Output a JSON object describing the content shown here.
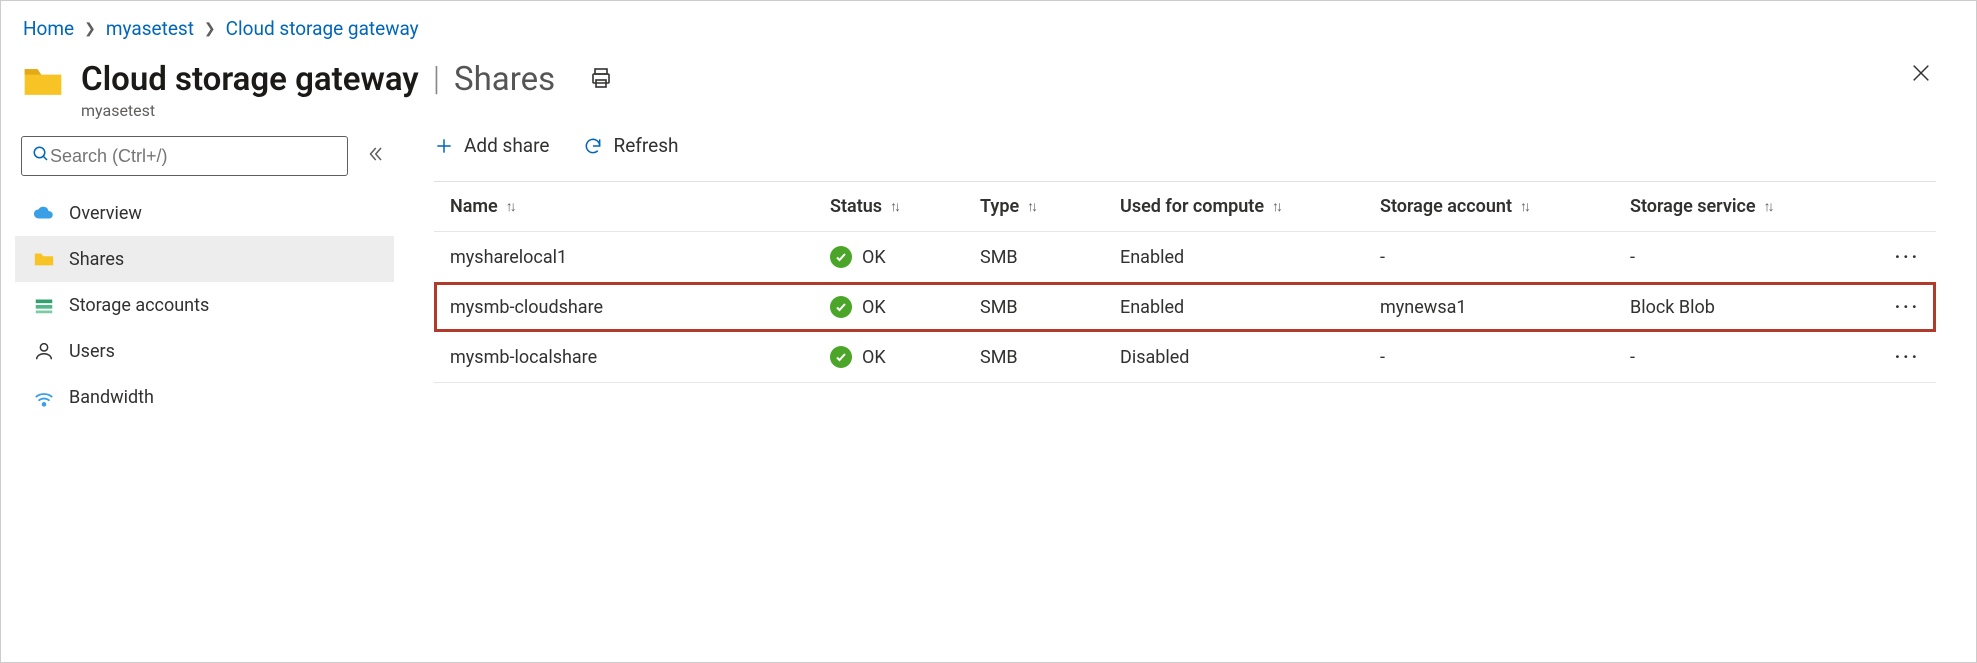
{
  "breadcrumb": {
    "items": [
      "Home",
      "myasetest",
      "Cloud storage gateway"
    ]
  },
  "header": {
    "title": "Cloud storage gateway",
    "section": "Shares",
    "subtitle": "myasetest"
  },
  "sidebar": {
    "search_placeholder": "Search (Ctrl+/)",
    "items": [
      {
        "label": "Overview",
        "icon": "cloud",
        "selected": false
      },
      {
        "label": "Shares",
        "icon": "folder",
        "selected": true
      },
      {
        "label": "Storage accounts",
        "icon": "storage",
        "selected": false
      },
      {
        "label": "Users",
        "icon": "user",
        "selected": false
      },
      {
        "label": "Bandwidth",
        "icon": "signal",
        "selected": false
      }
    ]
  },
  "toolbar": {
    "add_label": "Add share",
    "refresh_label": "Refresh"
  },
  "table": {
    "columns": [
      "Name",
      "Status",
      "Type",
      "Used for compute",
      "Storage account",
      "Storage service"
    ],
    "rows": [
      {
        "name": "mysharelocal1",
        "status": "OK",
        "type": "SMB",
        "compute": "Enabled",
        "account": "-",
        "service": "-",
        "highlight": false
      },
      {
        "name": "mysmb-cloudshare",
        "status": "OK",
        "type": "SMB",
        "compute": "Enabled",
        "account": "mynewsa1",
        "service": "Block Blob",
        "highlight": true
      },
      {
        "name": "mysmb-localshare",
        "status": "OK",
        "type": "SMB",
        "compute": "Disabled",
        "account": "-",
        "service": "-",
        "highlight": false
      }
    ]
  }
}
